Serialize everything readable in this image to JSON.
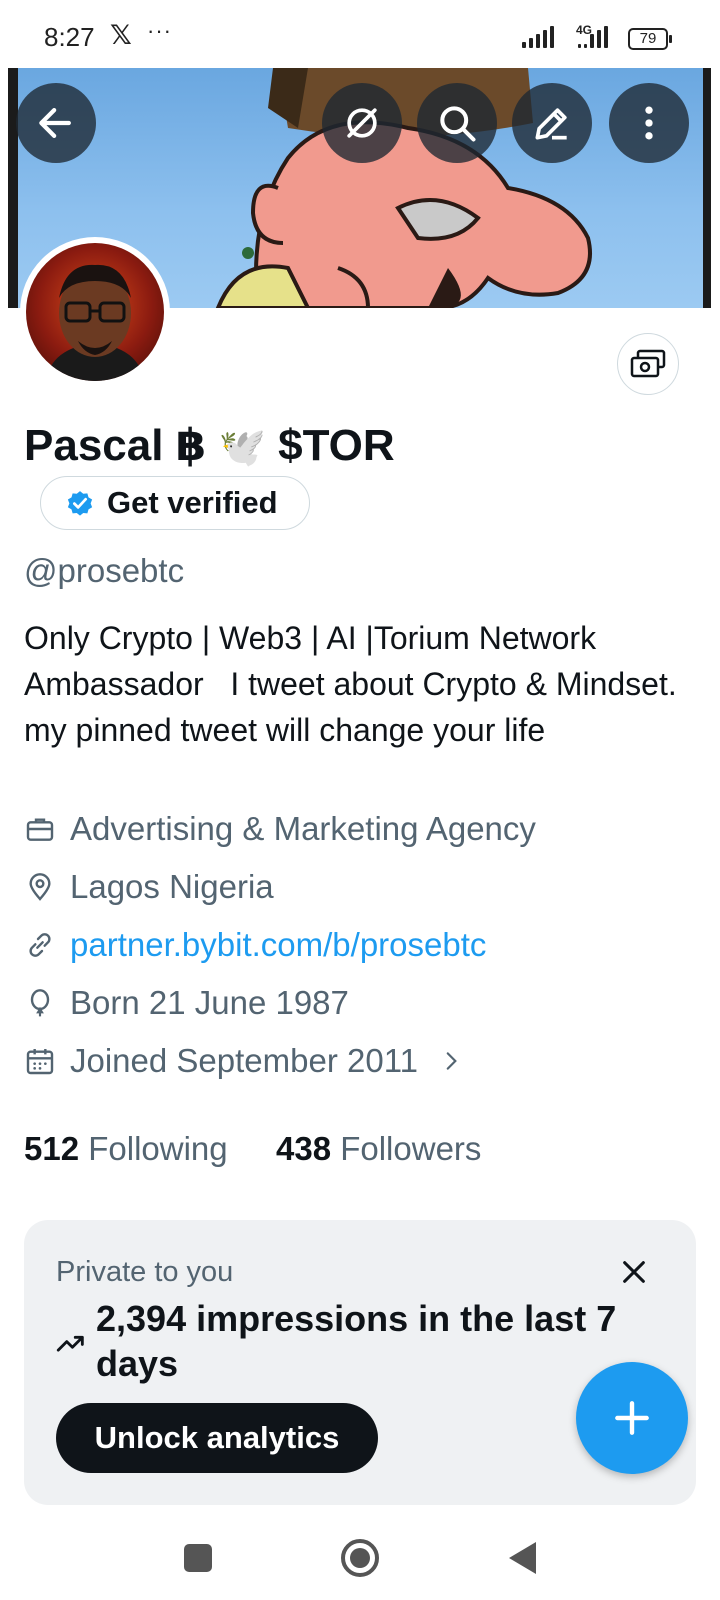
{
  "status_bar": {
    "time": "8:27",
    "x_logo": "𝕏",
    "more": "···",
    "network": "4G",
    "battery": "79"
  },
  "header": {
    "back_icon": "arrow-left-icon",
    "icons": [
      "no-sync-icon",
      "search-icon",
      "edit-icon",
      "more-vertical-icon"
    ]
  },
  "profile": {
    "name": "Pascal ฿",
    "name_emoji": "🕊️",
    "name_suffix": "$TOR",
    "get_verified_label": "Get verified",
    "handle": "@prosebtc",
    "bio": "Only Crypto | Web3 | AI |Torium Network Ambassador   I tweet about Crypto & Mindset. my pinned tweet will change your life",
    "category": "Advertising & Marketing Agency",
    "location": "Lagos Nigeria",
    "website": "partner.bybit.com/b/prosebtc",
    "born": "Born 21 June 1987",
    "joined": "Joined September 2011",
    "following_count": "512",
    "following_label": "Following",
    "followers_count": "438",
    "followers_label": "Followers"
  },
  "analytics_card": {
    "title": "Private to you",
    "text": "2,394 impressions in the last 7 days",
    "button": "Unlock analytics"
  },
  "colors": {
    "accent": "#1d9bf0",
    "text_primary": "#0f1419",
    "text_secondary": "#536471",
    "card_bg": "#eff1f3"
  }
}
